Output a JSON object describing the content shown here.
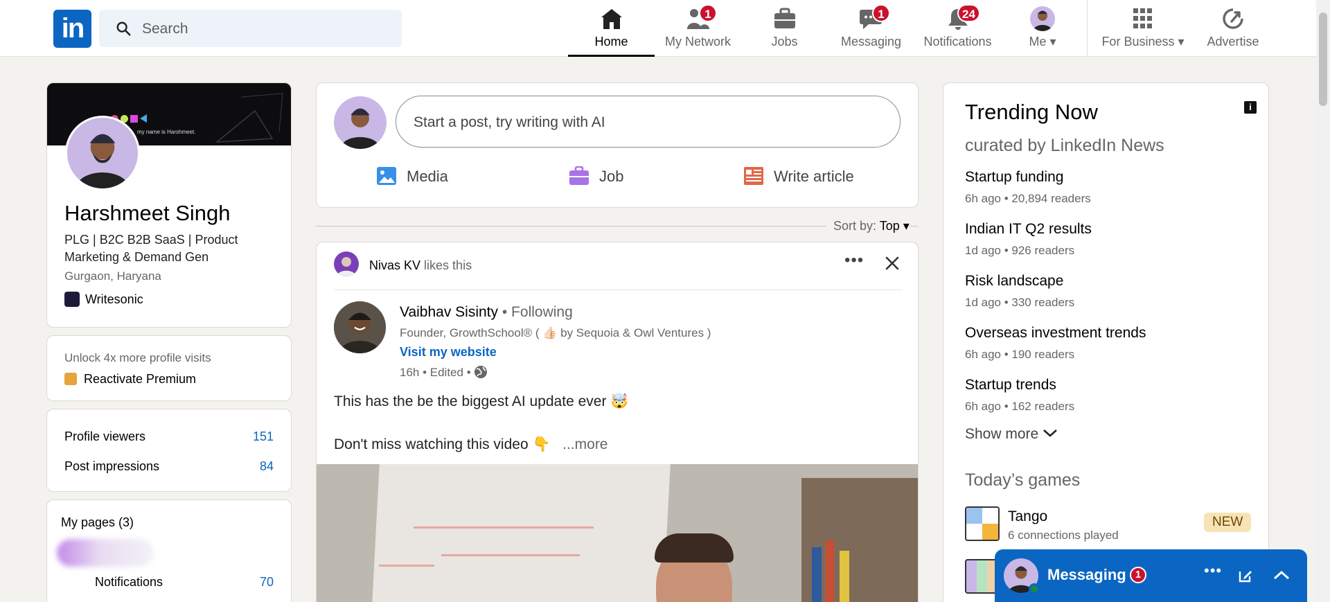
{
  "nav": {
    "logo": "in",
    "search_placeholder": "Search",
    "items": [
      {
        "label": "Home",
        "badge": ""
      },
      {
        "label": "My Network",
        "badge": "1"
      },
      {
        "label": "Jobs",
        "badge": ""
      },
      {
        "label": "Messaging",
        "badge": "1"
      },
      {
        "label": "Notifications",
        "badge": "24"
      },
      {
        "label": "Me",
        "badge": ""
      },
      {
        "label": "For Business",
        "badge": ""
      },
      {
        "label": "Advertise",
        "badge": ""
      }
    ]
  },
  "profile": {
    "cover_text": "my name is Harshmeet.",
    "name": "Harshmeet Singh",
    "tagline": "PLG | B2C B2B SaaS | Product Marketing & Demand Gen",
    "location": "Gurgaon, Haryana",
    "company": "Writesonic"
  },
  "premium": {
    "prompt": "Unlock 4x more profile visits",
    "cta": "Reactivate Premium"
  },
  "stats": [
    {
      "label": "Profile viewers",
      "value": "151"
    },
    {
      "label": "Post impressions",
      "value": "84"
    }
  ],
  "pages": {
    "title": "My pages (3)",
    "notifications_label": "Notifications",
    "notifications_value": "70"
  },
  "composer": {
    "placeholder": "Start a post, try writing with AI",
    "actions": [
      "Media",
      "Job",
      "Write article"
    ]
  },
  "sort": {
    "label": "Sort by:",
    "value": "Top"
  },
  "post": {
    "context_name": "Nivas KV",
    "context_text": "likes this",
    "author": "Vaibhav Sisinty",
    "following": "• Following",
    "headline": "Founder, GrowthSchool® ( 👍🏻 by Sequoia & Owl Ventures )",
    "website": "Visit my website",
    "meta": "16h • Edited •",
    "line1": "This has the be the biggest AI update ever 🤯",
    "line2": "Don't miss watching this video 👇",
    "more": "...more"
  },
  "trending": {
    "title": "Trending Now",
    "subtitle": "curated by LinkedIn News",
    "items": [
      {
        "title": "Startup funding",
        "meta": "6h ago • 20,894 readers"
      },
      {
        "title": "Indian IT Q2 results",
        "meta": "1d ago • 926 readers"
      },
      {
        "title": "Risk landscape",
        "meta": "1d ago • 330 readers"
      },
      {
        "title": "Overseas investment trends",
        "meta": "6h ago • 190 readers"
      },
      {
        "title": "Startup trends",
        "meta": "6h ago • 162 readers"
      }
    ],
    "show_more": "Show more",
    "games_title": "Today’s games",
    "game_name": "Tango",
    "game_meta": "6 connections played",
    "game_badge": "NEW"
  },
  "messaging": {
    "label": "Messaging",
    "badge": "1"
  },
  "colors": {
    "brand": "#0a66c2",
    "badge": "#cb112d",
    "background": "#f4f2ee"
  }
}
